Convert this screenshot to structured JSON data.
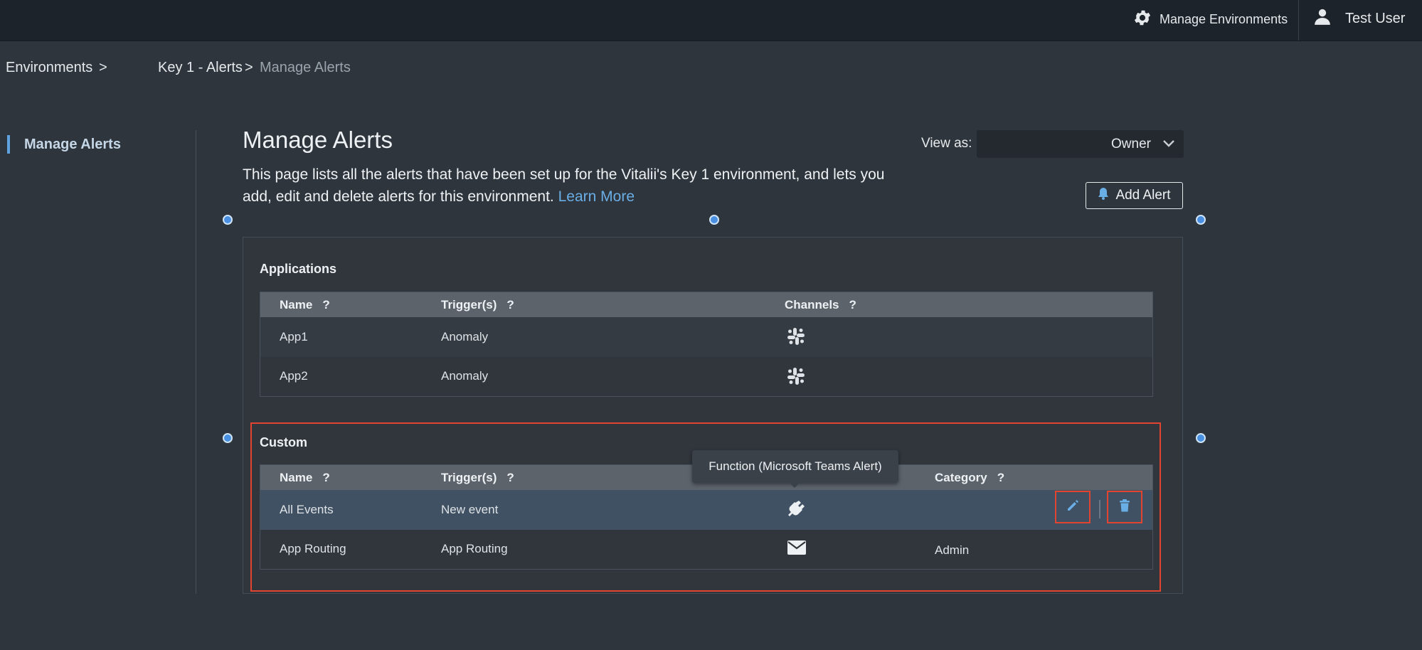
{
  "topbar": {
    "manage_environments": "Manage Environments",
    "user_name": "Test User"
  },
  "breadcrumb": {
    "environments": "Environments",
    "sep1": ">",
    "alerts": "Key 1 - Alerts",
    "sep2": ">",
    "current": "Manage Alerts"
  },
  "sidebar": {
    "item_label": "Manage Alerts"
  },
  "page": {
    "title": "Manage Alerts",
    "description": "This page lists all the alerts that have been set up for the Vitalii's Key 1 environment, and lets you add, edit and delete alerts for this environment.",
    "learn_more": "Learn More"
  },
  "view_as": {
    "label": "View as:",
    "value": "Owner"
  },
  "add_alert_label": "Add Alert",
  "applications": {
    "title": "Applications",
    "headers": {
      "name": "Name",
      "triggers": "Trigger(s)",
      "channels": "Channels",
      "help": "?"
    },
    "rows": [
      {
        "name": "App1",
        "trigger": "Anomaly",
        "channel_icon": "slack-icon"
      },
      {
        "name": "App2",
        "trigger": "Anomaly",
        "channel_icon": "slack-icon"
      }
    ]
  },
  "custom": {
    "title": "Custom",
    "headers": {
      "name": "Name",
      "triggers": "Trigger(s)",
      "category": "Category",
      "help": "?"
    },
    "rows": [
      {
        "name": "All Events",
        "trigger": "New event",
        "channel_icon": "plug-icon",
        "category": ""
      },
      {
        "name": "App Routing",
        "trigger": "App Routing",
        "channel_icon": "mail-icon",
        "category": "Admin"
      }
    ]
  },
  "tooltip": "Function (Microsoft Teams Alert)",
  "colors": {
    "accent": "#5ea3e0",
    "highlight": "#e2442f",
    "link": "#6aaee6",
    "background": "#2f353c",
    "topbar": "#1d232a"
  }
}
